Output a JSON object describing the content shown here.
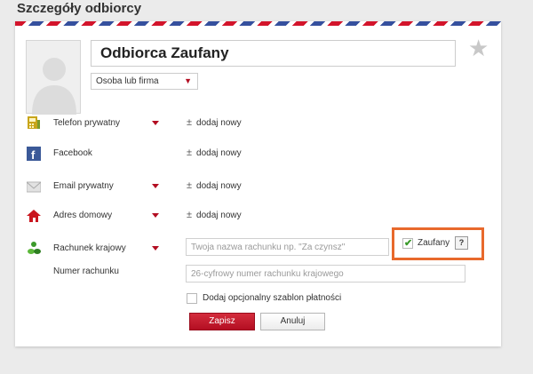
{
  "page": {
    "title": "Szczegóły odbiorcy"
  },
  "header": {
    "name_value": "Odbiorca Zaufany",
    "type_select": "Osoba lub firma"
  },
  "rows": {
    "phone": {
      "label": "Telefon prywatny",
      "add": "dodaj nowy",
      "icon": "phone-icon"
    },
    "facebook": {
      "label": "Facebook",
      "add": "dodaj nowy",
      "icon": "facebook-icon"
    },
    "email": {
      "label": "Email prywatny",
      "add": "dodaj nowy",
      "icon": "envelope-icon"
    },
    "address": {
      "label": "Adres domowy",
      "add": "dodaj nowy",
      "icon": "house-icon"
    },
    "account": {
      "label": "Rachunek krajowy",
      "name_placeholder": "Twoja nazwa rachunku np. \"Za czynsz\"",
      "trusted_label": "Zaufany",
      "trusted_checked": true,
      "help": "?",
      "icon": "money-icon"
    },
    "account_number": {
      "label": "Numer rachunku",
      "placeholder": "26-cyfrowy numer rachunku krajowego"
    }
  },
  "template": {
    "label": "Dodaj opcjonalny szablon płatności"
  },
  "actions": {
    "save": "Zapisz",
    "cancel": "Anuluj"
  },
  "colors": {
    "accent_red": "#b30e22",
    "highlight_orange": "#e8692c",
    "check_green": "#3a9a2a"
  }
}
